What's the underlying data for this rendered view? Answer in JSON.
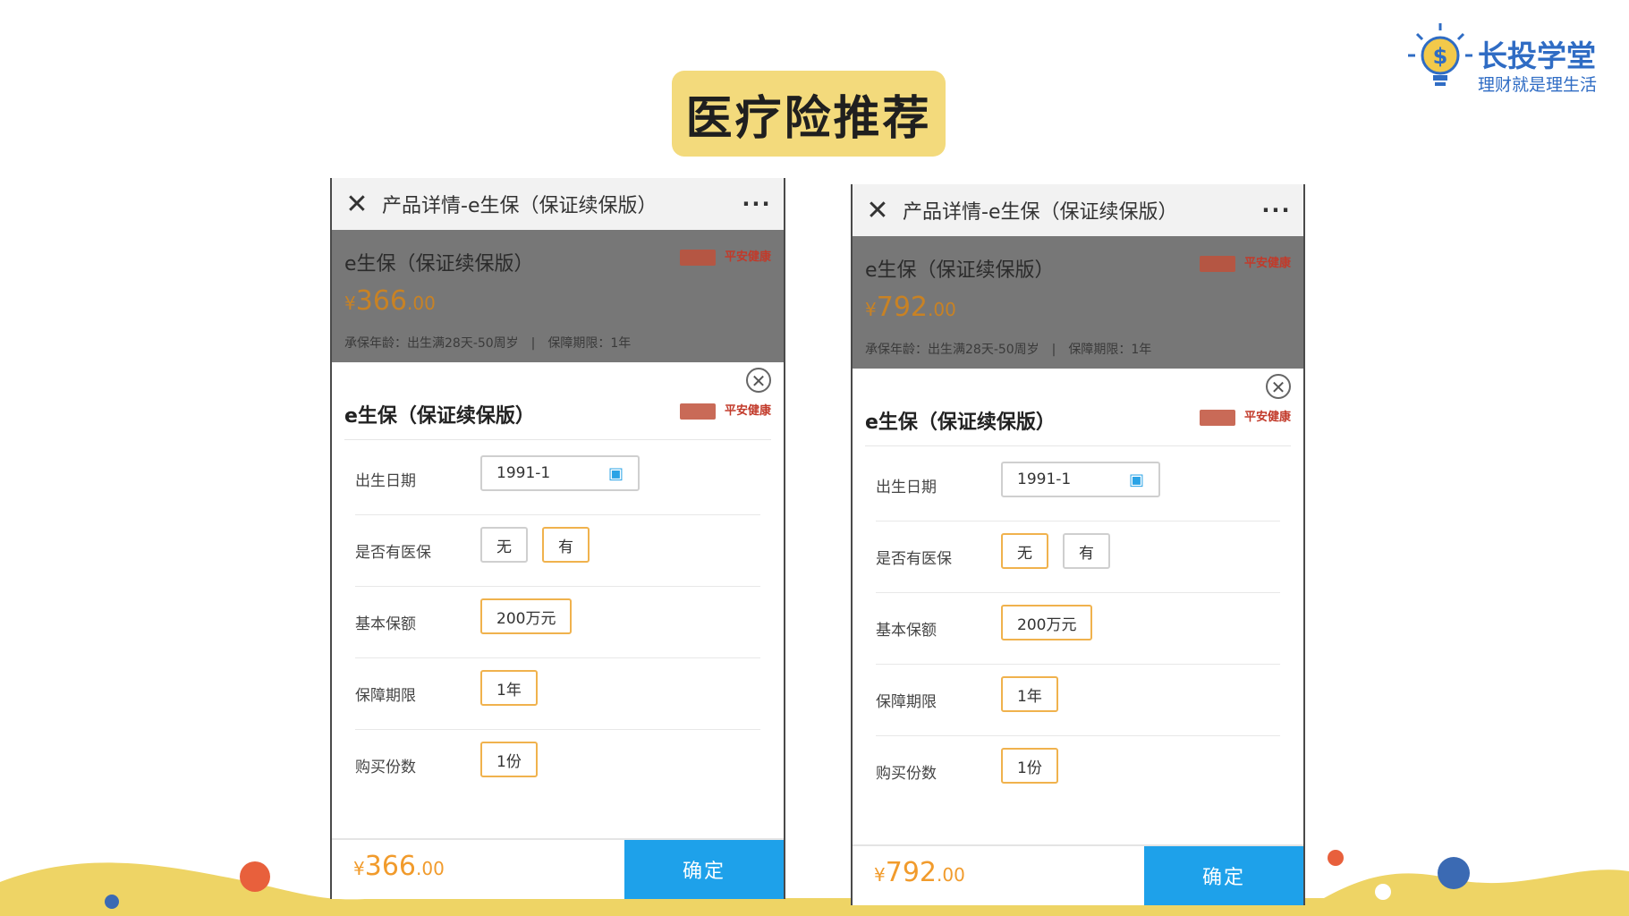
{
  "slide": {
    "title": "医疗险推荐",
    "brand": {
      "name": "长投学堂",
      "slogan": "理财就是理生活"
    }
  },
  "colors": {
    "title_bg": "#f3da7c",
    "accent_price": "#f19b2c",
    "confirm_button": "#1ea1ea",
    "selected_option_border": "#f0b24d",
    "brand_blue": "#2f6cc4"
  },
  "phones": [
    {
      "nav": {
        "close_icon": "close-icon",
        "title": "产品详情-e生保（保证续保版）",
        "more": "···"
      },
      "overlay": {
        "product_name": "e生保（保证续保版）",
        "currency": "¥",
        "price_int": "366",
        "price_dec": ".00",
        "meta": "承保年龄：出生满28天-50周岁　|　保障期限：1年",
        "insurer": "平安健康"
      },
      "sheet": {
        "close": "✕",
        "title": "e生保（保证续保版）",
        "insurer": "平安健康",
        "rows": [
          {
            "label": "出生日期",
            "value": "1991-1"
          },
          {
            "label": "是否有医保",
            "opt_a": "无",
            "opt_b": "有",
            "selected": "有"
          },
          {
            "label": "基本保额",
            "value": "200万元"
          },
          {
            "label": "保障期限",
            "value": "1年"
          },
          {
            "label": "购买份数",
            "value": "1份"
          }
        ]
      },
      "footer": {
        "currency": "¥",
        "price_int": "366",
        "price_dec": ".00",
        "confirm": "确定"
      }
    },
    {
      "nav": {
        "close_icon": "close-icon",
        "title": "产品详情-e生保（保证续保版）",
        "more": "···"
      },
      "overlay": {
        "product_name": "e生保（保证续保版）",
        "currency": "¥",
        "price_int": "792",
        "price_dec": ".00",
        "meta": "承保年龄：出生满28天-50周岁　|　保障期限：1年",
        "insurer": "平安健康"
      },
      "sheet": {
        "close": "✕",
        "title": "e生保（保证续保版）",
        "insurer": "平安健康",
        "rows": [
          {
            "label": "出生日期",
            "value": "1991-1"
          },
          {
            "label": "是否有医保",
            "opt_a": "无",
            "opt_b": "有",
            "selected": "无"
          },
          {
            "label": "基本保额",
            "value": "200万元"
          },
          {
            "label": "保障期限",
            "value": "1年"
          },
          {
            "label": "购买份数",
            "value": "1份"
          }
        ]
      },
      "footer": {
        "currency": "¥",
        "price_int": "792",
        "price_dec": ".00",
        "confirm": "确定"
      }
    }
  ]
}
